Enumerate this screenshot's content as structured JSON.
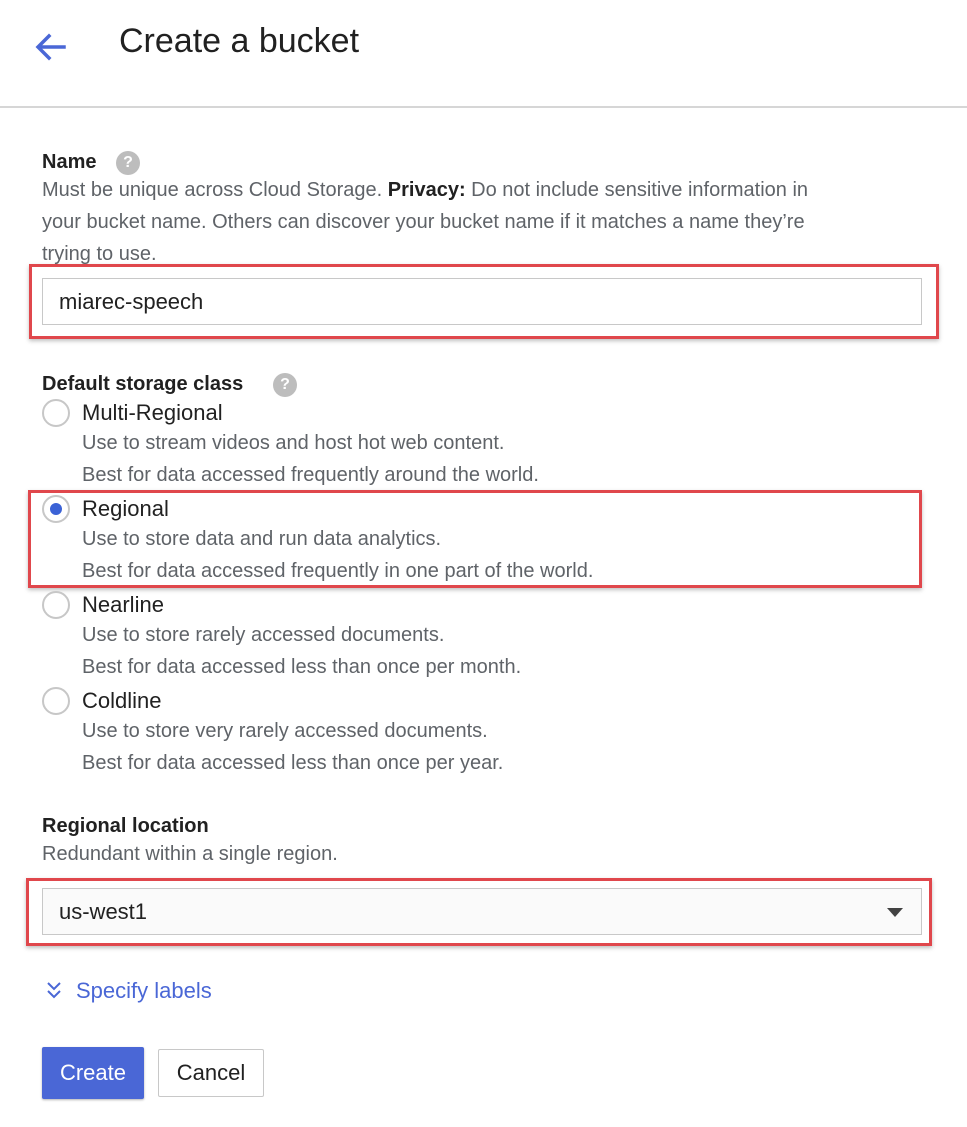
{
  "header": {
    "title": "Create a bucket",
    "back_icon": "arrow-left-icon",
    "accent": "#4a67d6"
  },
  "name_section": {
    "label": "Name",
    "help": "?",
    "desc_line1_a": "Must be unique across Cloud Storage. ",
    "desc_line1_b": "Privacy:",
    "desc_line1_c": " Do not include sensitive information in",
    "desc_line2": "your bucket name. Others can discover your bucket name if it matches a name they’re",
    "desc_line3": "trying to use.",
    "value": "miarec-speech"
  },
  "storage_class": {
    "label": "Default storage class",
    "help": "?",
    "options": [
      {
        "title": "Multi-Regional",
        "desc1": "Use to stream videos and host hot web content.",
        "desc2": "Best for data accessed frequently around the world.",
        "selected": false
      },
      {
        "title": "Regional",
        "desc1": "Use to store data and run data analytics.",
        "desc2": "Best for data accessed frequently in one part of the world.",
        "selected": true
      },
      {
        "title": "Nearline",
        "desc1": "Use to store rarely accessed documents.",
        "desc2": "Best for data accessed less than once per month.",
        "selected": false
      },
      {
        "title": "Coldline",
        "desc1": "Use to store very rarely accessed documents.",
        "desc2": "Best for data accessed less than once per year.",
        "selected": false
      }
    ]
  },
  "location": {
    "label": "Regional location",
    "desc": "Redundant within a single region.",
    "value": "us-west1"
  },
  "labels_link": "Specify labels",
  "buttons": {
    "create": "Create",
    "cancel": "Cancel"
  },
  "colors": {
    "highlight": "#e0474c",
    "primary": "#4a67d6",
    "radio_selected": "#3b62d6"
  }
}
